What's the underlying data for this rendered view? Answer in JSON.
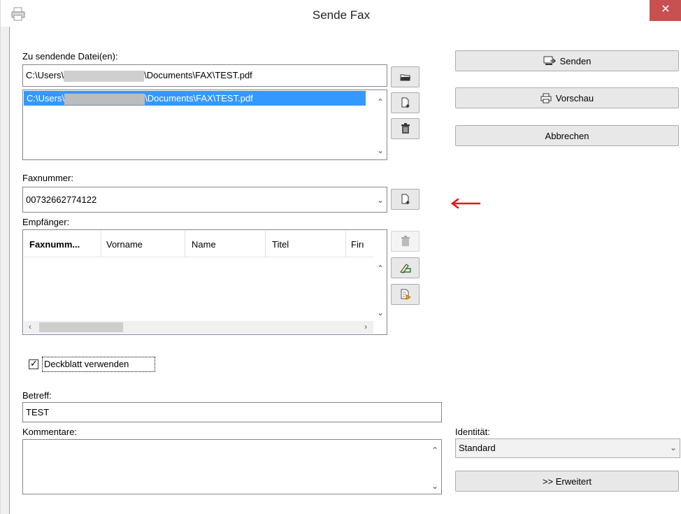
{
  "window": {
    "title": "Sende Fax",
    "close_glyph": "✕"
  },
  "files": {
    "label": "Zu sendende Datei(en):",
    "path_prefix": "C:\\Users\\",
    "path_suffix": "\\Documents\\FAX\\TEST.pdf",
    "list_items": [
      {
        "prefix": "C:\\Users\\",
        "suffix": "\\Documents\\FAX\\TEST.pdf",
        "selected": true
      }
    ]
  },
  "faxnumber": {
    "label": "Faxnummer:",
    "value": "00732662774122"
  },
  "recipients": {
    "label": "Empfänger:",
    "columns": [
      "Faxnumm...",
      "Vorname",
      "Name",
      "Titel",
      "Firı"
    ]
  },
  "coverpage": {
    "label": "Deckblatt verwenden",
    "checked": true
  },
  "subject": {
    "label": "Betreff:",
    "value": "TEST"
  },
  "comments": {
    "label": "Kommentare:",
    "value": ""
  },
  "identity": {
    "label": "Identität:",
    "selected": "Standard"
  },
  "buttons": {
    "send": "Senden",
    "preview": "Vorschau",
    "cancel": "Abbrechen",
    "advanced": ">> Erweitert"
  },
  "colors": {
    "selection": "#3399ff",
    "annotation_arrow": "#e8141e"
  }
}
